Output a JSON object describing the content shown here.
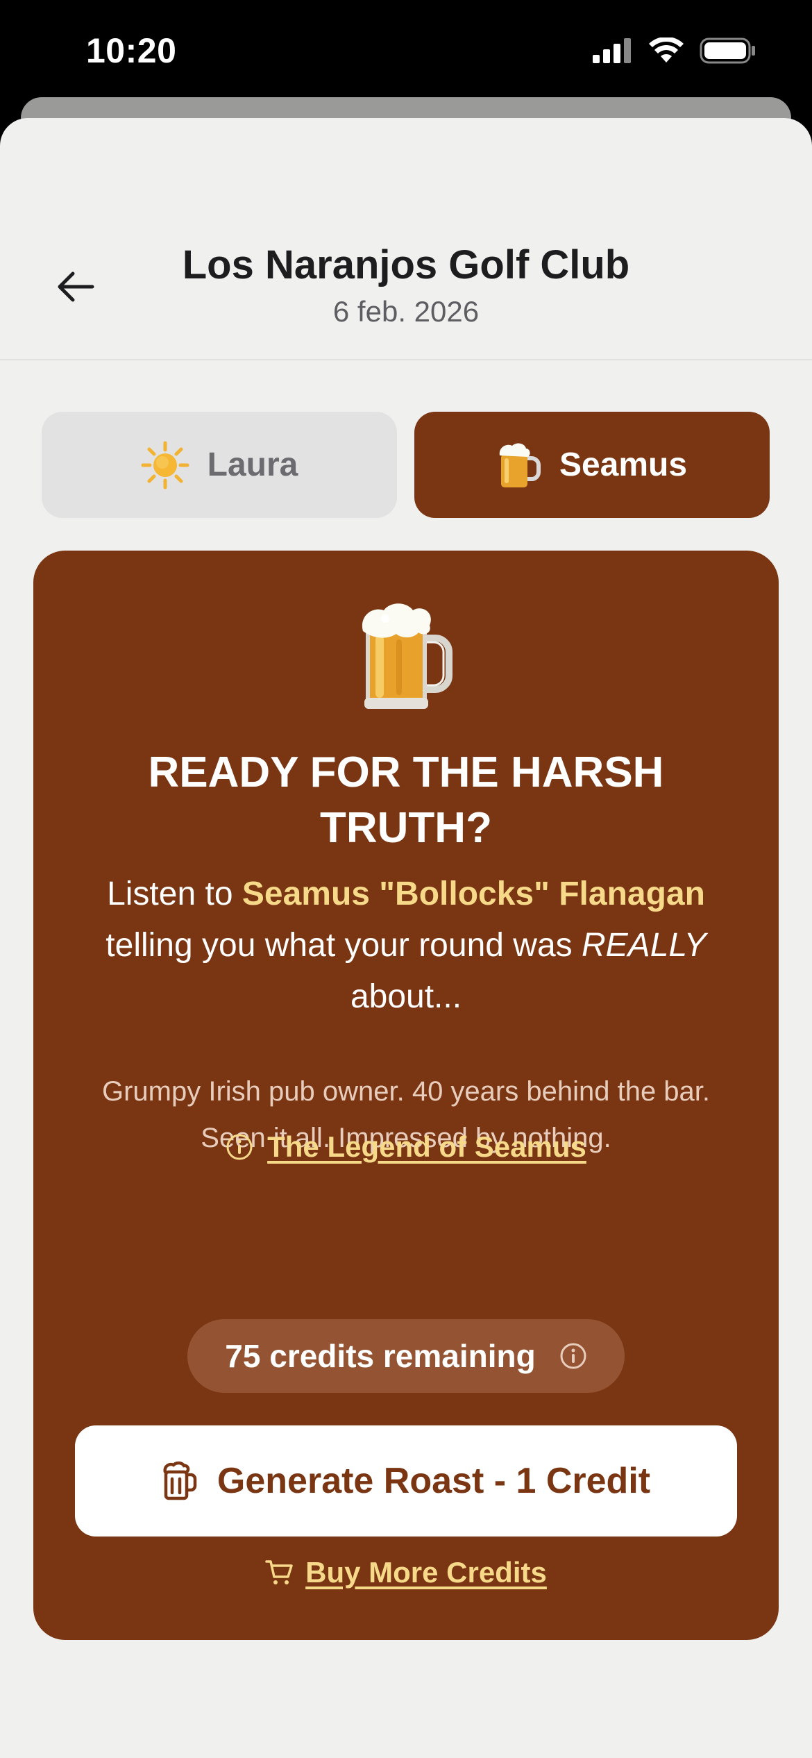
{
  "status_bar": {
    "time": "10:20"
  },
  "header": {
    "title": "Los Naranjos Golf Club",
    "date": "6 feb. 2026"
  },
  "tabs": [
    {
      "label": "Laura",
      "icon": "sun-icon",
      "selected": false
    },
    {
      "label": "Seamus",
      "icon": "beer-icon",
      "selected": true
    }
  ],
  "card": {
    "icon": "beer-mug-icon",
    "heading": "READY FOR THE HARSH TRUTH?",
    "desc_prefix": "Listen to ",
    "desc_name": "Seamus \"Bollocks\" Flanagan",
    "desc_middle": " telling you what your round was ",
    "desc_emphasis": "REALLY",
    "desc_suffix": " about...",
    "bio_line1": "Grumpy Irish pub owner. 40 years behind the bar.",
    "bio_line2": "Seen it all. Impressed by nothing.",
    "legend_link": "The Legend of Seamus",
    "credits_text": "75 credits remaining",
    "generate_button": "Generate Roast - 1 Credit",
    "buy_link": "Buy More Credits"
  },
  "colors": {
    "accent_brown": "#7a3512",
    "link_yellow": "#f7d98a",
    "background": "#f0f1ef"
  }
}
